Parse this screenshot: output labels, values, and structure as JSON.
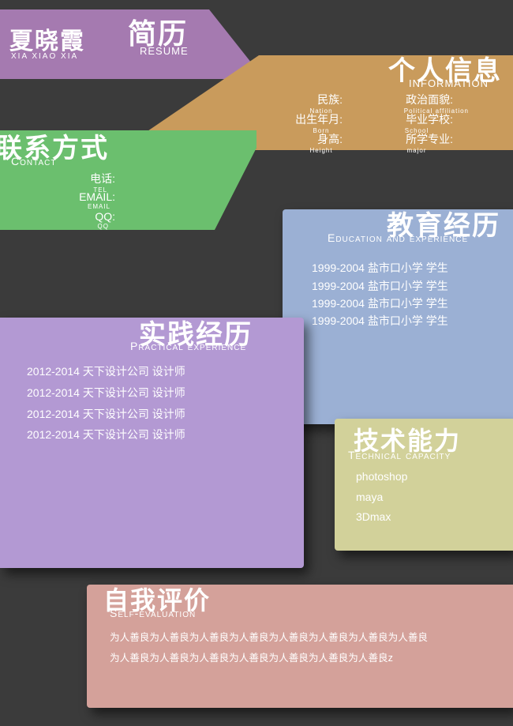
{
  "colors": {
    "background": "#3b3b3b",
    "header_purple": "#a57ab0",
    "info_orange": "#c99b5c",
    "contact_green": "#6bbf6e",
    "education_blue": "#9bb0d4",
    "practice_purple": "#b399d3",
    "skills_khaki": "#d2d19a",
    "self_pink": "#d4a19a"
  },
  "header": {
    "name": "夏晓霞",
    "name_pinyin": "XIA  XIAO XIA",
    "title": "简历",
    "title_en": "RESUME"
  },
  "info": {
    "title": "个人信息",
    "title_en": "INFORMATION",
    "fields": [
      {
        "label": "民族:",
        "sub": "Nation"
      },
      {
        "label": "出生年月:",
        "sub": "Born"
      },
      {
        "label": "身高:",
        "sub": "Height"
      },
      {
        "label": "政治面貌:",
        "sub": "Political affiliation"
      },
      {
        "label": "毕业学校:",
        "sub": "School"
      },
      {
        "label": "所学专业:",
        "sub": "major"
      }
    ]
  },
  "contact": {
    "title": "联系方式",
    "title_en": "Contact",
    "fields": [
      {
        "label": "电话:",
        "sub": "TEL"
      },
      {
        "label": "EMAIL:",
        "sub": "EMAIL"
      },
      {
        "label": "QQ:",
        "sub": "QQ"
      }
    ]
  },
  "education": {
    "title": "教育经历",
    "title_en": "Education and experience",
    "rows": [
      "1999-2004  盐市口小学   学生",
      "1999-2004  盐市口小学   学生",
      "1999-2004  盐市口小学   学生",
      "1999-2004  盐市口小学   学生"
    ]
  },
  "practice": {
    "title": "实践经历",
    "title_en": "Practical experience",
    "rows": [
      "2012-2014  天下设计公司  设计师",
      "2012-2014  天下设计公司  设计师",
      "2012-2014  天下设计公司  设计师",
      "2012-2014  天下设计公司  设计师"
    ]
  },
  "skills": {
    "title": "技术能力",
    "title_en": "Technical capacity",
    "items": [
      "photoshop",
      "maya",
      "3Dmax"
    ]
  },
  "self": {
    "title": "自我评价",
    "title_en": "Self-evaluation",
    "lines": [
      "为人善良为人善良为人善良为人善良为人善良为人善良为人善良为人善良",
      "为人善良为人善良为人善良为人善良为人善良为人善良为人善良z"
    ]
  }
}
